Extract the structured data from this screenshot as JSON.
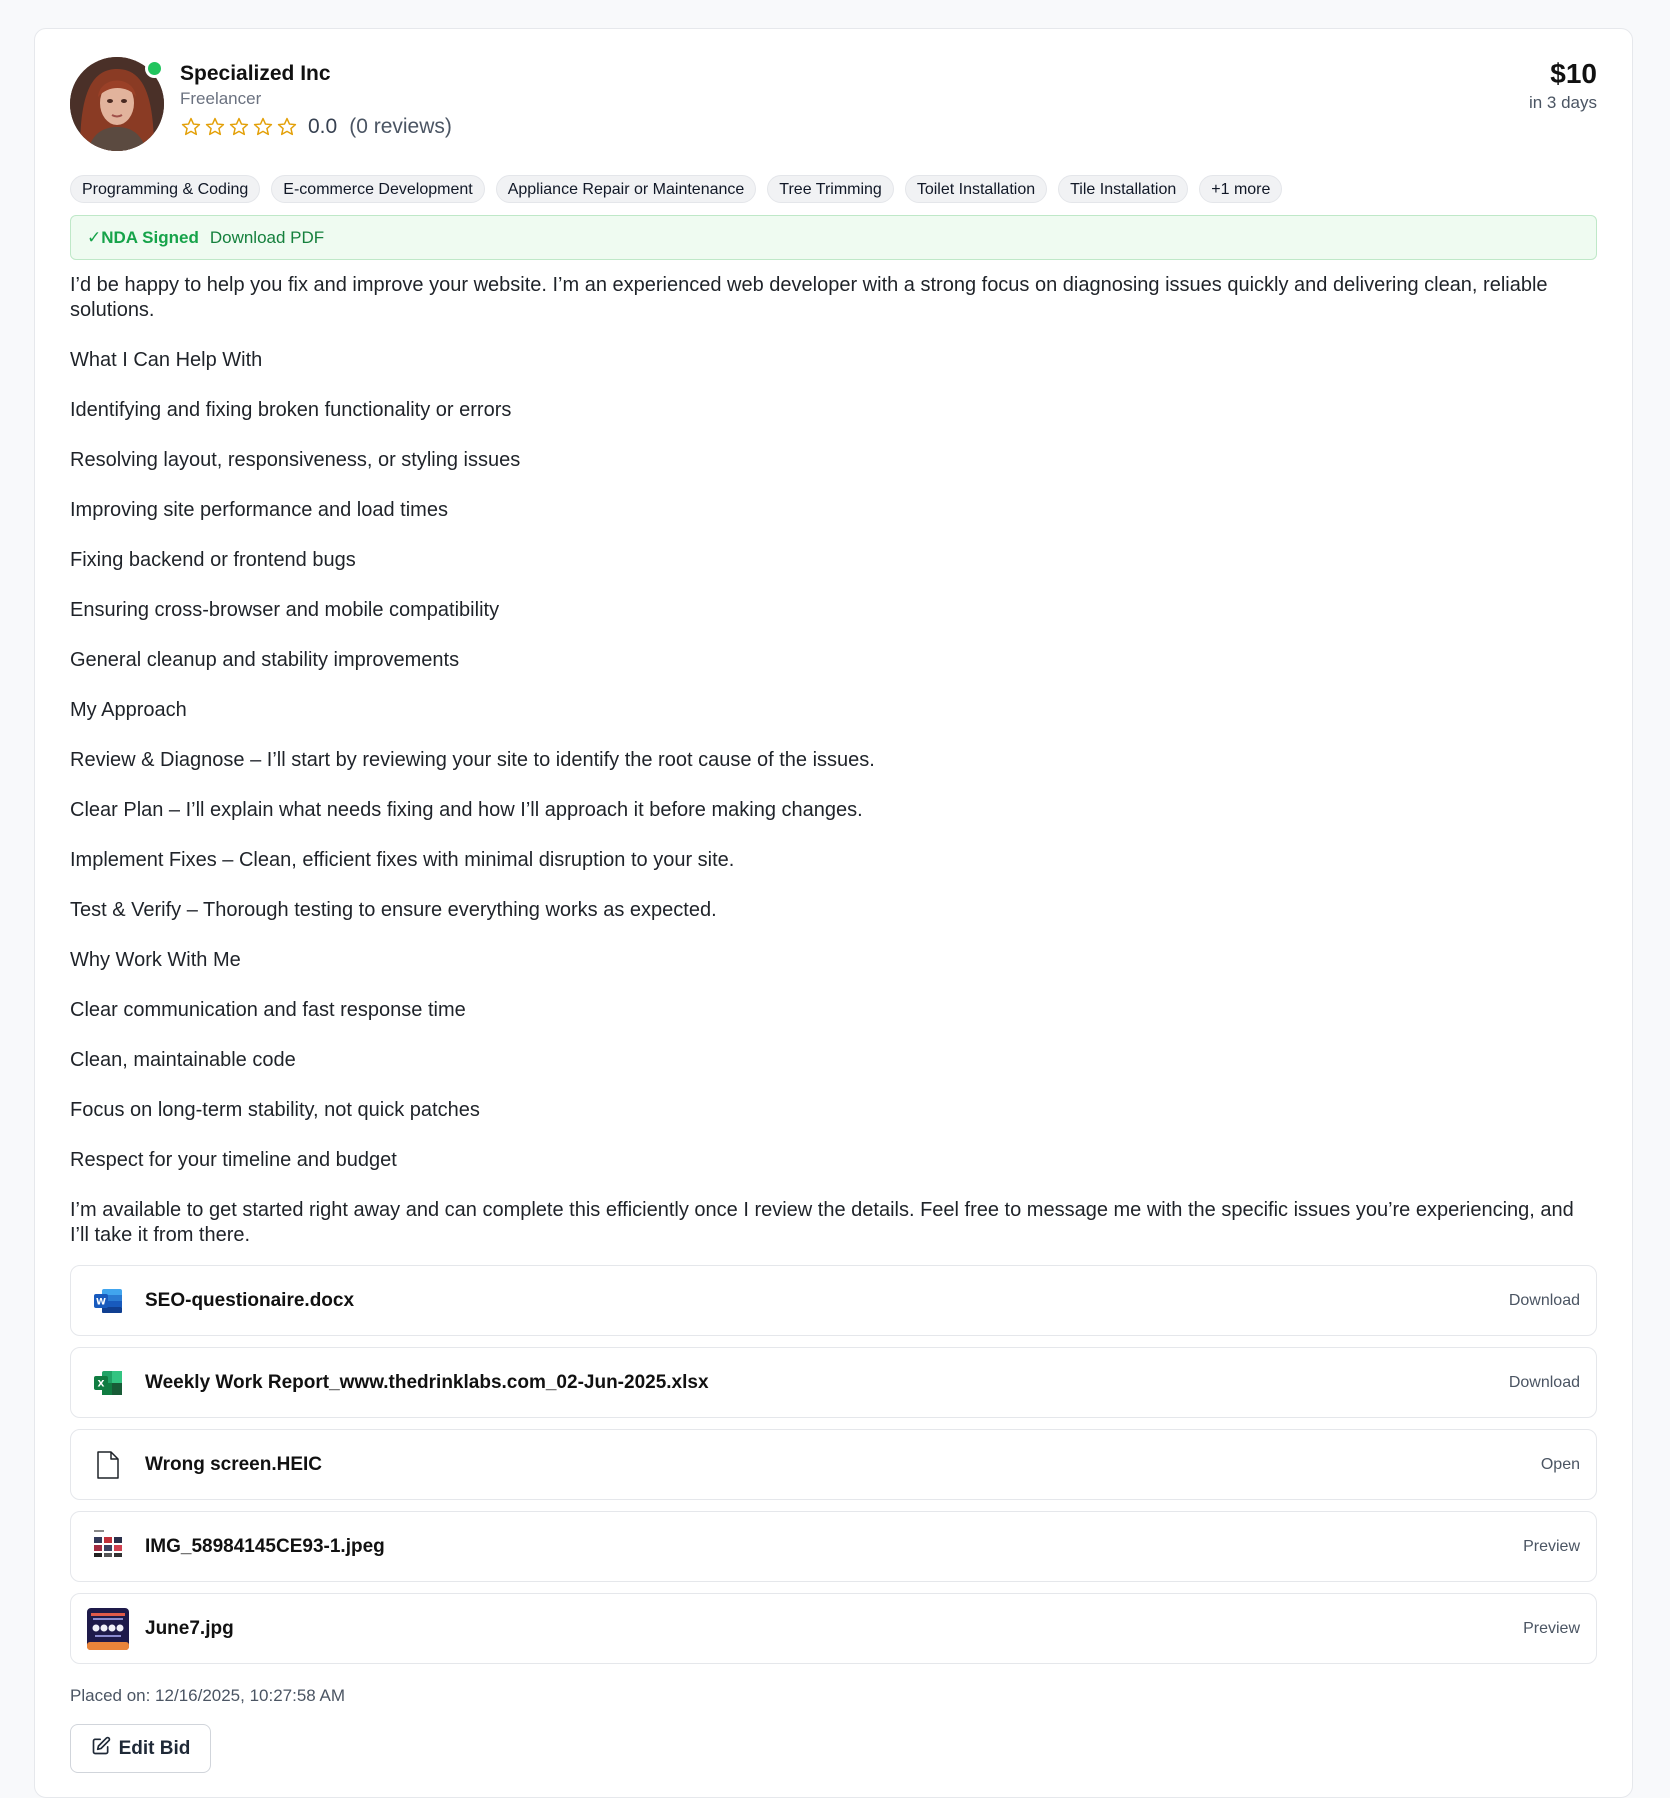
{
  "profile": {
    "name": "Specialized Inc",
    "role": "Freelancer",
    "rating": "0.0",
    "review_count": "(0 reviews)",
    "online_color": "#22c55e",
    "star_color": "#e3a008"
  },
  "bid": {
    "price": "$10",
    "timeline": "in 3 days"
  },
  "tags": [
    "Programming & Coding",
    "E-commerce Development",
    "Appliance Repair or Maintenance",
    "Tree Trimming",
    "Toilet Installation",
    "Tile Installation",
    "+1 more"
  ],
  "nda": {
    "status": "✓NDA Signed",
    "link": "Download PDF"
  },
  "description": [
    "I’d be happy to help you fix and improve your website. I’m an experienced web developer with a strong focus on diagnosing issues quickly and delivering clean, reliable solutions.",
    "What I Can Help With",
    "Identifying and fixing broken functionality or errors",
    "Resolving layout, responsiveness, or styling issues",
    "Improving site performance and load times",
    "Fixing backend or frontend bugs",
    "Ensuring cross-browser and mobile compatibility",
    "General cleanup and stability improvements",
    "My Approach",
    "Review & Diagnose – I’ll start by reviewing your site to identify the root cause of the issues.",
    "Clear Plan – I’ll explain what needs fixing and how I’ll approach it before making changes.",
    "Implement Fixes – Clean, efficient fixes with minimal disruption to your site.",
    "Test & Verify – Thorough testing to ensure everything works as expected.",
    "Why Work With Me",
    "Clear communication and fast response time",
    "Clean, maintainable code",
    "Focus on long-term stability, not quick patches",
    "Respect for your timeline and budget",
    "I’m available to get started right away and can complete this efficiently once I review the details. Feel free to message me with the specific issues you’re experiencing, and I’ll take it from there."
  ],
  "attachments": [
    {
      "name": "SEO-questionaire.docx",
      "action": "Download",
      "icon": "word-doc-icon"
    },
    {
      "name": "Weekly Work Report_www.thedrinklabs.com_02-Jun-2025.xlsx",
      "action": "Download",
      "icon": "excel-sheet-icon"
    },
    {
      "name": "Wrong screen.HEIC",
      "action": "Open",
      "icon": "generic-file-icon"
    },
    {
      "name": "IMG_58984145CE93-1.jpeg",
      "action": "Preview",
      "icon": "image-thumbnail-icon"
    },
    {
      "name": "June7.jpg",
      "action": "Preview",
      "icon": "image-thumbnail-icon"
    }
  ],
  "placed_on": "Placed on: 12/16/2025, 10:27:58 AM",
  "edit_button": "Edit Bid"
}
